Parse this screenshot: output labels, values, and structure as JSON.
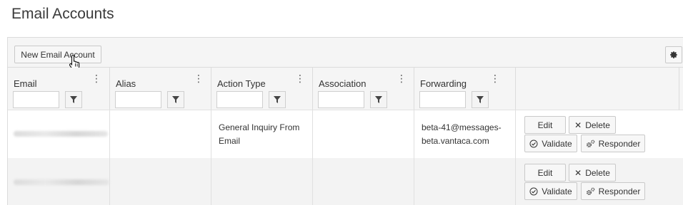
{
  "page": {
    "title": "Email Accounts"
  },
  "toolbar": {
    "new_label": "New Email Account"
  },
  "columns": [
    {
      "label": "Email"
    },
    {
      "label": "Alias"
    },
    {
      "label": "Action Type"
    },
    {
      "label": "Association"
    },
    {
      "label": "Forwarding"
    }
  ],
  "rows": [
    {
      "action_type_line1": "General Inquiry From",
      "action_type_line2": "Email",
      "forwarding_line1": "beta-41@messages-",
      "forwarding_line2": "beta.vantaca.com"
    },
    {
      "action_type_line1": "",
      "action_type_line2": "",
      "forwarding_line1": "",
      "forwarding_line2": ""
    }
  ],
  "commands": {
    "edit": "Edit",
    "delete": "Delete",
    "validate": "Validate",
    "responder": "Responder"
  },
  "icons": [
    "filter-icon",
    "kebab-menu-icon",
    "gear-icon",
    "close-icon",
    "check-circle-icon",
    "cogs-icon",
    "hand-pointer-icon"
  ]
}
